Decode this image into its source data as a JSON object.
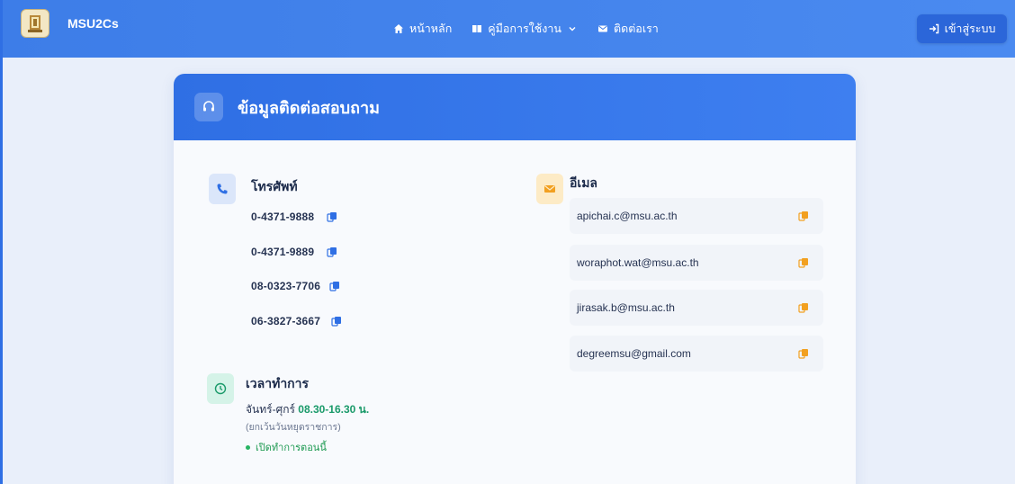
{
  "navbar": {
    "brand": "MSU2Cs",
    "links": [
      {
        "label": "หน้าหลัก",
        "icon": "home-icon"
      },
      {
        "label": "คู่มือการใช้งาน",
        "icon": "book-icon"
      },
      {
        "label": "ติดต่อเรา",
        "icon": "mail-icon"
      }
    ],
    "login_label": "เข้าสู่ระบบ"
  },
  "card": {
    "title": "ข้อมูลติดต่อสอบถาม",
    "phone": {
      "title": "โทรศัพท์",
      "numbers": [
        "0-4371-9888",
        "0-4371-9889",
        "08-0323-7706",
        "06-3827-3667"
      ]
    },
    "email": {
      "title": "อีเมล",
      "addresses": [
        "apichai.c@msu.ac.th",
        "woraphot.wat@msu.ac.th",
        "jirasak.b@msu.ac.th",
        "degreemsu@gmail.com"
      ]
    },
    "hours": {
      "title": "เวลาทำการ",
      "days": "จันทร์-ศุกร์",
      "time": "08.30-16.30 น.",
      "note": "(ยกเว้นวันหยุดราชการ)",
      "status": "เปิดทำการตอนนี้"
    }
  },
  "colors": {
    "primary": "#3d7de8",
    "phone_accent": "#2f6fe4",
    "email_accent": "#f2a020",
    "hours_accent": "#1a9a6a"
  }
}
